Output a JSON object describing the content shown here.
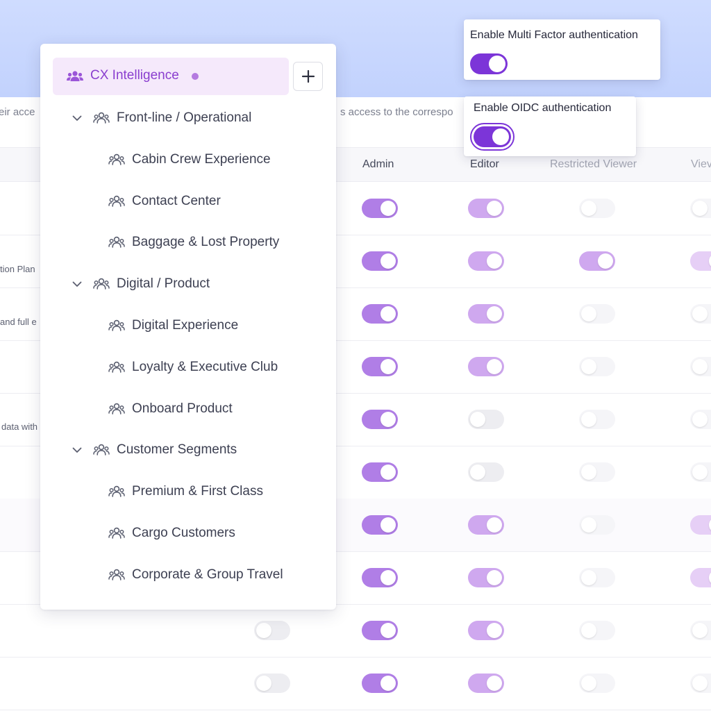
{
  "background": {
    "desc_left": "eir acce",
    "desc_right": "s access to the correspo",
    "columns": {
      "admin": "Admin",
      "editor": "Editor",
      "restricted_viewer": "Restricted Viewer",
      "viewer": "Viev"
    },
    "row_fragments": {
      "r2": "tion Plan",
      "r3": "and full e",
      "r5": "data with"
    }
  },
  "permission_rows": [
    {
      "admin": true,
      "editor": true,
      "restricted": false,
      "viewer": false
    },
    {
      "admin": true,
      "editor": true,
      "restricted": true,
      "viewer": true
    },
    {
      "admin": true,
      "editor": true,
      "restricted": false,
      "viewer": false
    },
    {
      "admin": true,
      "editor": true,
      "restricted": false,
      "viewer": false
    },
    {
      "admin": true,
      "editor": false,
      "restricted": false,
      "viewer": false
    },
    {
      "admin": true,
      "editor": false,
      "restricted": false,
      "viewer": false
    },
    {
      "admin": true,
      "editor": true,
      "restricted": false,
      "viewer": true
    },
    {
      "admin": true,
      "editor": true,
      "restricted": false,
      "viewer": true
    },
    {
      "extra": false,
      "admin": true,
      "editor": true,
      "restricted": false,
      "viewer": false
    },
    {
      "extra": false,
      "admin": true,
      "editor": true,
      "restricted": false,
      "viewer": false
    }
  ],
  "tree": {
    "root": {
      "label": "CX Intelligence",
      "icon": "users-icon"
    },
    "add_label": "+",
    "groups": [
      {
        "label": "Front-line / Operational",
        "expanded": true,
        "children": [
          "Cabin Crew Experience",
          "Contact Center",
          "Baggage & Lost Property"
        ]
      },
      {
        "label": "Digital / Product",
        "expanded": true,
        "children": [
          "Digital Experience",
          "Loyalty & Executive Club",
          "Onboard Product"
        ]
      },
      {
        "label": "Customer Segments",
        "expanded": true,
        "children": [
          "Premium & First Class",
          "Cargo Customers",
          "Corporate & Group Travel"
        ]
      }
    ]
  },
  "mfa": {
    "title": "Enable Multi Factor authentication",
    "enabled": true
  },
  "oidc": {
    "title": "Enable OIDC authentication",
    "enabled": true
  },
  "colors": {
    "accent": "#7c35d8",
    "toggle_on": "#b07ee6",
    "tree_highlight": "#f5e9fb",
    "root_text": "#8a3ecf"
  }
}
